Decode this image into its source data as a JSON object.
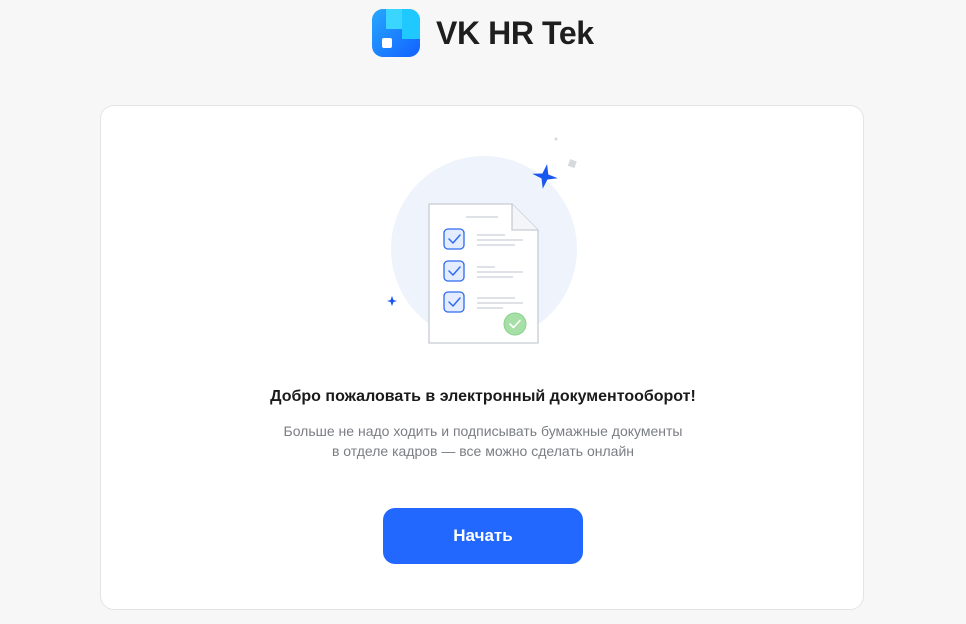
{
  "header": {
    "brand_name": "VK HR Tek",
    "logo_icon": "vk-hr-tek-logo-icon"
  },
  "welcome": {
    "illustration_icon": "document-checklist-icon",
    "title": "Добро пожаловать в электронный документооборот!",
    "subtitle_line1": "Больше не надо ходить и подписывать бумажные документы",
    "subtitle_line2": "в отделе кадров — все можно сделать онлайн",
    "start_label": "Начать"
  },
  "colors": {
    "accent": "#2268ff",
    "background": "#f7f7f7",
    "card": "#ffffff",
    "success": "#a7e0a6"
  }
}
